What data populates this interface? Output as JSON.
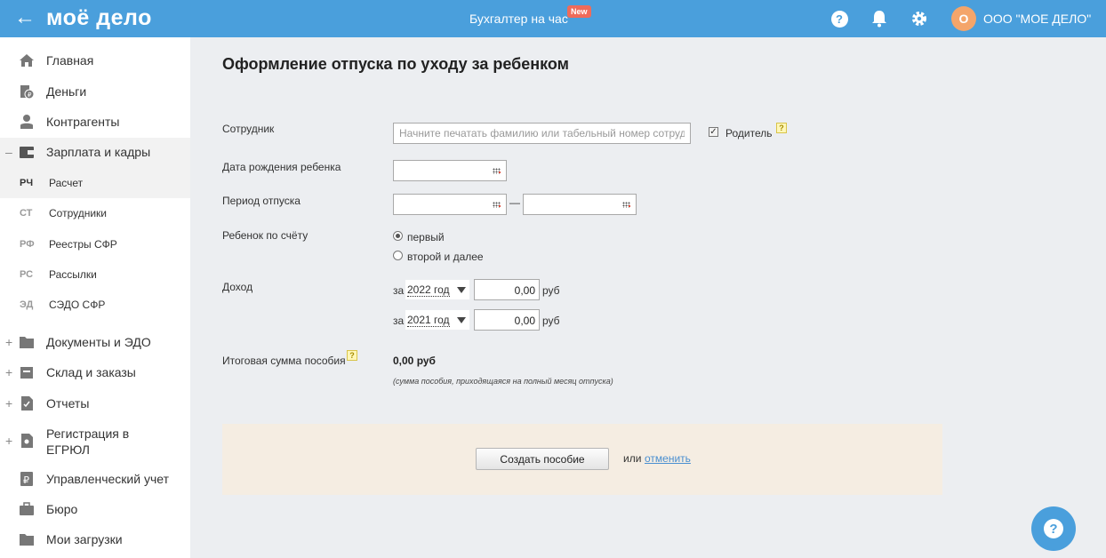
{
  "header": {
    "logo": "моё дело",
    "accountant": "Бухгалтер на час",
    "new_badge": "New",
    "avatar_letter": "О",
    "org_name": "ООО \"МОЕ ДЕЛО\"",
    "accent_color": "#4a9fdc"
  },
  "sidebar": {
    "items": [
      {
        "label": "Главная",
        "icon": "home-icon"
      },
      {
        "label": "Деньги",
        "icon": "money-icon"
      },
      {
        "label": "Контрагенты",
        "icon": "contractors-icon"
      },
      {
        "label": "Зарплата и кадры",
        "icon": "wallet-icon",
        "toggle": "–"
      },
      {
        "label": "Документы и ЭДО",
        "icon": "folder-icon",
        "toggle": "+"
      },
      {
        "label": "Склад и заказы",
        "icon": "warehouse-icon",
        "toggle": "+"
      },
      {
        "label": "Отчеты",
        "icon": "reports-icon",
        "toggle": "+"
      },
      {
        "label": "Регистрация в",
        "label2": "ЕГРЮЛ",
        "icon": "registration-icon",
        "toggle": "+"
      },
      {
        "label": "Управленческий учет",
        "icon": "ruble-icon"
      },
      {
        "label": "Бюро",
        "icon": "briefcase-icon"
      },
      {
        "label": "Мои загрузки",
        "icon": "downloads-icon"
      }
    ],
    "sub_items": [
      {
        "code": "РЧ",
        "label": "Расчет"
      },
      {
        "code": "СТ",
        "label": "Сотрудники"
      },
      {
        "code": "РФ",
        "label": "Реестры СФР"
      },
      {
        "code": "РС",
        "label": "Рассылки"
      },
      {
        "code": "ЭД",
        "label": "СЭДО СФР"
      }
    ]
  },
  "form": {
    "title": "Оформление отпуска по уходу за ребенком",
    "employee_label": "Сотрудник",
    "employee_placeholder": "Начните печатать фамилию или табельный номер сотрудника",
    "parent_label": "Родитель",
    "hint_mark": "?",
    "birth_label": "Дата рождения ребенка",
    "period_label": "Период отпуска",
    "period_dash": "—",
    "child_label": "Ребенок по счёту",
    "child_options": [
      "первый",
      "второй и далее"
    ],
    "income_label": "Доход",
    "income_rows": [
      {
        "prefix": "за",
        "year": "2022 год",
        "amount": "0,00",
        "unit": "руб"
      },
      {
        "prefix": "за",
        "year": "2021 год",
        "amount": "0,00",
        "unit": "руб"
      }
    ],
    "total_label": "Итоговая сумма пособия",
    "total_value": "0,00 руб",
    "total_note": "(сумма пособия, приходящаяся на полный месяц отпуска)",
    "create_button": "Создать пособие",
    "or_text": "или",
    "cancel_link": "отменить"
  },
  "help_fab": "?"
}
